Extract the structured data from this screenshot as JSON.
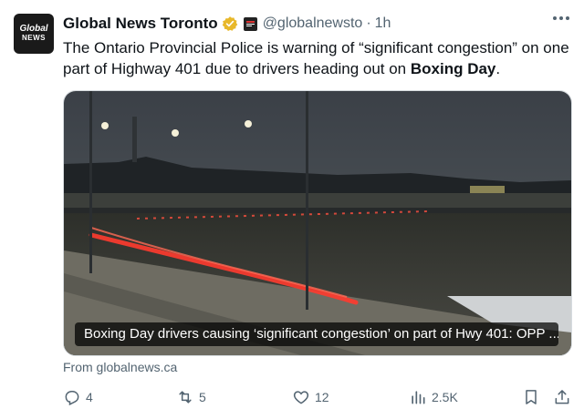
{
  "account": {
    "avatar_line1": "Global",
    "avatar_line2": "NEWS",
    "display_name": "Global News Toronto",
    "handle": "@globalnewsto",
    "separator": "·",
    "time": "1h"
  },
  "tweet": {
    "text_before": "The Ontario Provincial Police is warning of “significant congestion” on one part of Highway 401 due to drivers heading out on ",
    "text_bold": "Boxing Day",
    "text_after": "."
  },
  "card": {
    "caption": "Boxing Day drivers causing ‘significant congestion’ on part of Hwy 401: OPP ...",
    "source": "From globalnews.ca"
  },
  "actions": {
    "replies": "4",
    "reposts": "5",
    "likes": "12",
    "views": "2.5K"
  },
  "icons": [
    "verified-badge-icon",
    "affiliate-badge-icon",
    "more-icon",
    "reply-icon",
    "repost-icon",
    "like-icon",
    "views-icon",
    "bookmark-icon",
    "share-icon"
  ],
  "colors": {
    "verified": "#e8b82a",
    "secondary_text": "#536471"
  }
}
